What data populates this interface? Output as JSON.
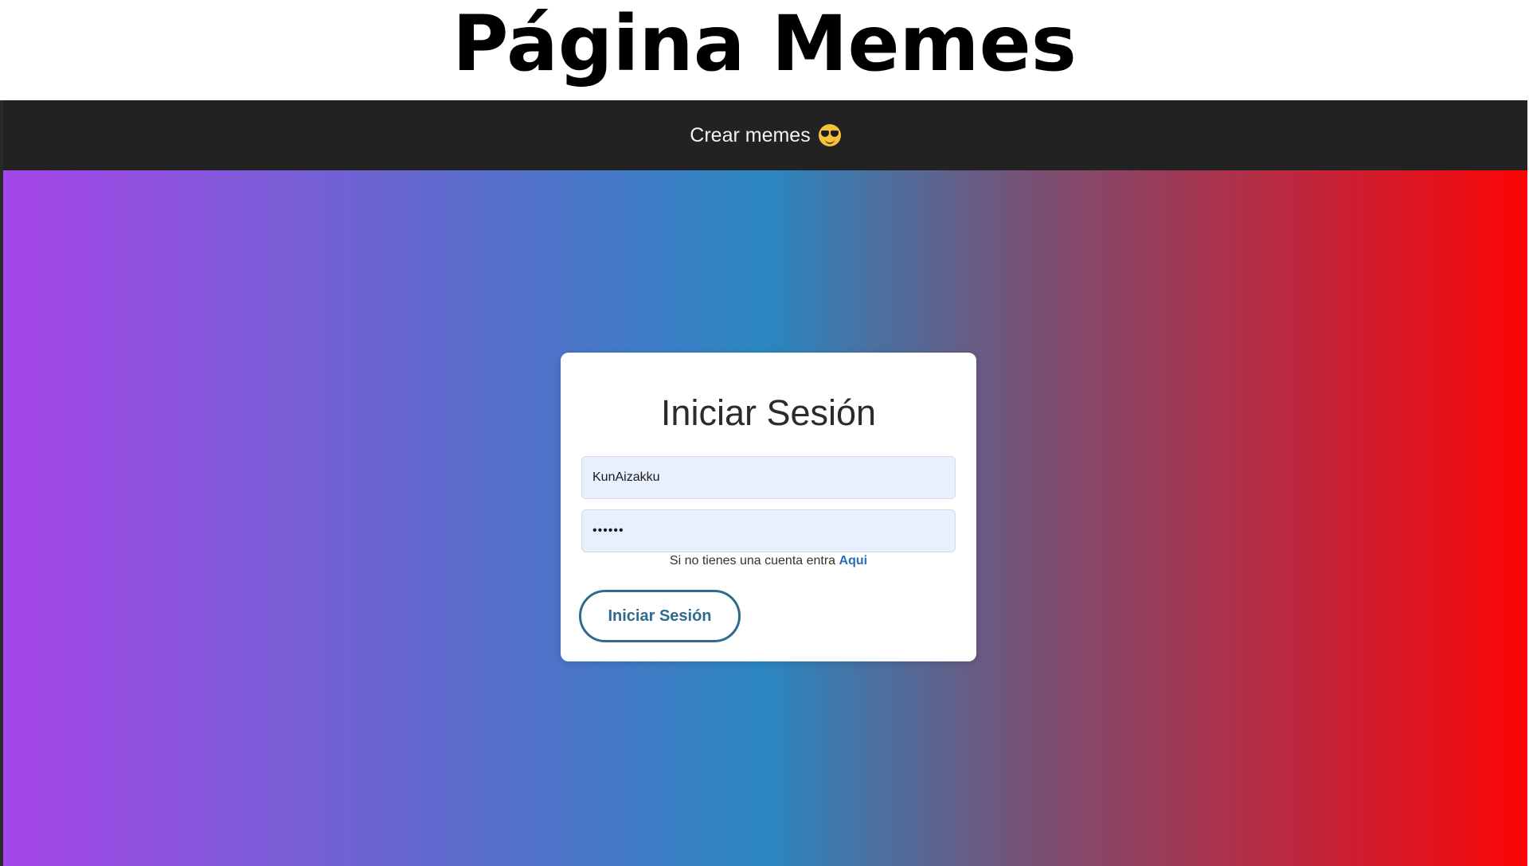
{
  "header": {
    "title": "Página Memes"
  },
  "navbar": {
    "brand_label": "Crear memes",
    "brand_icon": "smiling-face-with-sunglasses-icon"
  },
  "login": {
    "title": "Iniciar Sesión",
    "username_value": "KunAizakku",
    "password_value": "••••••",
    "register_text": "Si no tienes una cuenta entra",
    "register_link": "Aqui",
    "submit_label": "Iniciar Sesión"
  },
  "colors": {
    "navbar_bg": "#222222",
    "gradient_start": "#a646e8",
    "gradient_mid": "#2b87c1",
    "gradient_end": "#fb0505",
    "input_bg": "#e8f0fe",
    "button_accent": "#2e6b8e",
    "link": "#2a6db0"
  }
}
